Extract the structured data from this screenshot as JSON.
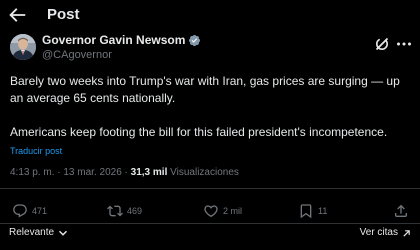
{
  "header": {
    "title": "Post"
  },
  "author": {
    "display_name": "Governor Gavin Newsom",
    "handle": "@CAgovernor",
    "verified": true
  },
  "tweet": {
    "paragraph_1_line_1": "Barely two weeks into Trump's war with Iran, gas prices are surging — up",
    "paragraph_1_line_2": "an average 65 cents nationally.",
    "paragraph_2": "Americans keep footing the bill for this failed president's incompetence.",
    "translate_label": "Traducir post"
  },
  "meta": {
    "time": "4:13 p. m.",
    "separator": "·",
    "date": "13 mar. 2026",
    "views_count": "31,3 mil",
    "views_label": "Visualizaciones"
  },
  "actions": {
    "replies": "471",
    "reposts": "469",
    "likes": "2 mil",
    "bookmarks": "11"
  },
  "bottom": {
    "sort_label": "Relevante",
    "quotes_label": "Ver citas"
  },
  "colors": {
    "background": "#000000",
    "text_primary": "#e7e9ea",
    "text_secondary": "#71767b",
    "accent": "#1d9bf0",
    "divider": "#2f3336"
  }
}
